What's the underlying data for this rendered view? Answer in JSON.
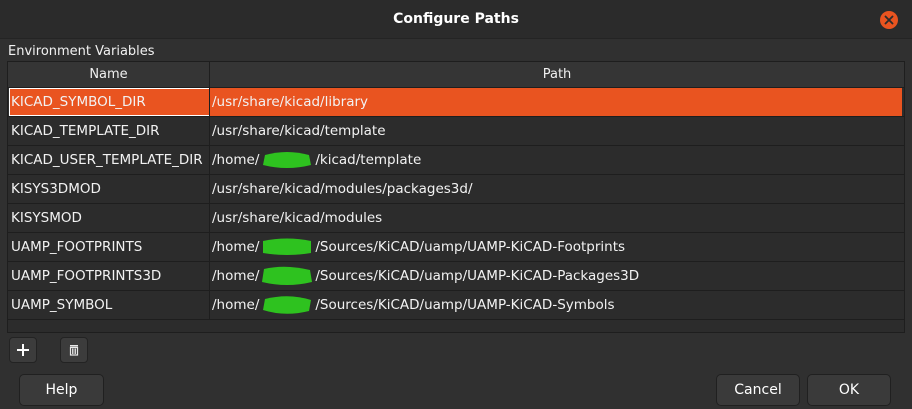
{
  "dialog": {
    "title": "Configure Paths",
    "close_icon": "close-icon"
  },
  "env": {
    "group_label": "Environment Variables",
    "columns": {
      "name": "Name",
      "path": "Path"
    },
    "rows": [
      {
        "name": "KICAD_SYMBOL_DIR",
        "path": "/usr/share/kicad/library"
      },
      {
        "name": "KICAD_TEMPLATE_DIR",
        "path": "/usr/share/kicad/template"
      },
      {
        "name": "KICAD_USER_TEMPLATE_DIR",
        "path_prefix": "/home/",
        "path_suffix": "/kicad/template"
      },
      {
        "name": "KISYS3DMOD",
        "path": "/usr/share/kicad/modules/packages3d/"
      },
      {
        "name": "KISYSMOD",
        "path": "/usr/share/kicad/modules"
      },
      {
        "name": "UAMP_FOOTPRINTS",
        "path_prefix": "/home/",
        "path_suffix": "/Sources/KiCAD/uamp/UAMP-KiCAD-Footprints"
      },
      {
        "name": "UAMP_FOOTPRINTS3D",
        "path_prefix": "/home/",
        "path_suffix": "/Sources/KiCAD/uamp/UAMP-KiCAD-Packages3D"
      },
      {
        "name": "UAMP_SYMBOL",
        "path_prefix": "/home/",
        "path_suffix": "/Sources/KiCAD/uamp/UAMP-KiCAD-Symbols"
      }
    ]
  },
  "toolbar": {
    "add_icon": "plus-icon",
    "delete_icon": "trash-icon"
  },
  "buttons": {
    "help": "Help",
    "cancel": "Cancel",
    "ok": "OK"
  },
  "colors": {
    "accent": "#e95420",
    "redaction": "#2ec21f",
    "background": "#303030"
  }
}
